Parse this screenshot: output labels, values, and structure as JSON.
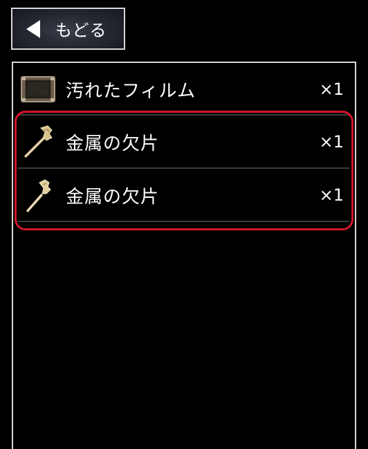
{
  "back_button": {
    "label": "もどる"
  },
  "inventory": {
    "items": [
      {
        "name": "汚れたフィルム",
        "quantity": "×1",
        "icon": "film-icon"
      },
      {
        "name": "金属の欠片",
        "quantity": "×1",
        "icon": "metal-fragment-icon"
      },
      {
        "name": "金属の欠片",
        "quantity": "×1",
        "icon": "metal-fragment-icon"
      }
    ]
  },
  "colors": {
    "background": "#000000",
    "border": "#d8d8d8",
    "highlight": "#d0182c",
    "text": "#ffffff"
  }
}
